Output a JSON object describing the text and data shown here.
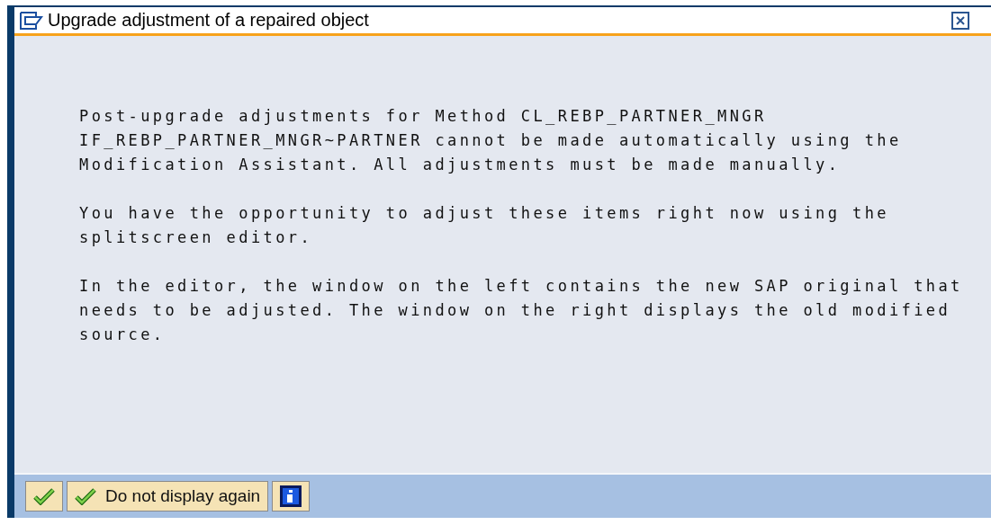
{
  "window": {
    "title": "Upgrade adjustment of a repaired object"
  },
  "paragraphs": [
    [
      "Post-upgrade adjustments for Method CL_REBP_PARTNER_MNGR",
      "IF_REBP_PARTNER_MNGR~PARTNER cannot be made automatically using the",
      "Modification Assistant. All adjustments must be made manually."
    ],
    [
      "You have the opportunity to adjust these items right now using the",
      "splitscreen editor."
    ],
    [
      "In the editor, the window on the left contains the new SAP original that",
      "needs to be adjusted. The window on the right displays the old modified",
      "source."
    ]
  ],
  "buttons": [
    {
      "kind": "check"
    },
    {
      "kind": "check",
      "label": "Do not display again"
    },
    {
      "kind": "info"
    }
  ]
}
